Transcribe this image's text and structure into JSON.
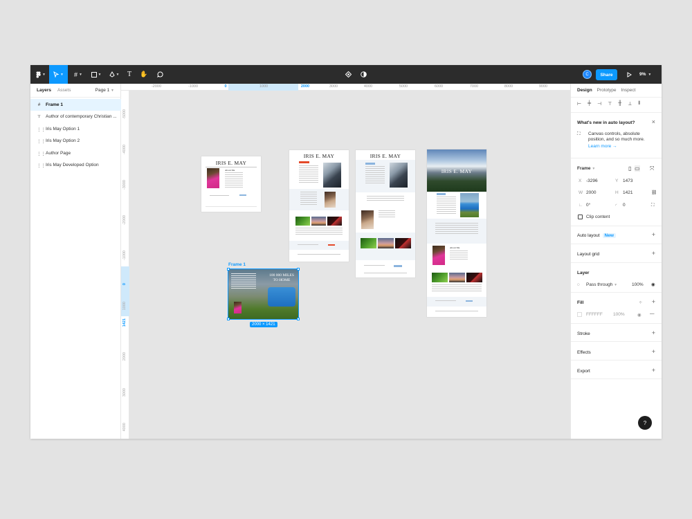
{
  "toolbar": {
    "tools": [
      "figma-menu",
      "move",
      "frame",
      "shape",
      "pen",
      "text",
      "hand",
      "comment"
    ],
    "avatar_initial": "C",
    "share_label": "Share",
    "zoom_label": "9%"
  },
  "layers_panel": {
    "tab_layers": "Layers",
    "tab_assets": "Assets",
    "page_label": "Page 1",
    "items": [
      {
        "icon": "frame-icon",
        "label": "Frame 1"
      },
      {
        "icon": "text-icon",
        "label": "Author of contemporary Christian ..."
      },
      {
        "icon": "grid-icon",
        "label": "Iris May Option 1"
      },
      {
        "icon": "grid-icon",
        "label": "Iris May Option 2"
      },
      {
        "icon": "grid-icon",
        "label": "Author Page"
      },
      {
        "icon": "grid-icon",
        "label": "Iris May Developed Option"
      }
    ]
  },
  "rulers": {
    "top_ticks": [
      "-2000",
      "-1000",
      "0",
      "1000",
      "2000",
      "3000",
      "4000",
      "5000",
      "6000",
      "7000",
      "8000",
      "9000"
    ],
    "left_ticks": [
      "-5000",
      "-4000",
      "-3000",
      "-2000",
      "-1000",
      "0",
      "1000",
      "1421",
      "2000",
      "3000",
      "4000"
    ]
  },
  "canvas": {
    "frame_label": "Frame 1",
    "size_badge": "2000 × 1421",
    "book_title": "100 000 MILES TO HOME",
    "site_title": "IRIS E. MAY",
    "about_heading": "About Me"
  },
  "design_panel": {
    "tab_design": "Design",
    "tab_prototype": "Prototype",
    "tab_inspect": "Inspect",
    "whats_new_title": "What's new in auto layout?",
    "whats_new_body": "Canvas controls, absolute position, and so much more.",
    "learn_more": "Learn more →",
    "frame_label": "Frame",
    "x_label": "X",
    "x_value": "-3296",
    "y_label": "Y",
    "y_value": "1473",
    "w_label": "W",
    "w_value": "2000",
    "h_label": "H",
    "h_value": "1421",
    "rotation_value": "0°",
    "radius_value": "0",
    "clip_content": "Clip content",
    "auto_layout": "Auto layout",
    "new_badge": "New",
    "layout_grid": "Layout grid",
    "layer_title": "Layer",
    "pass_through": "Pass through",
    "opacity": "100%",
    "fill_title": "Fill",
    "fill_hex": "FFFFFF",
    "fill_opacity": "100%",
    "stroke": "Stroke",
    "effects": "Effects",
    "export": "Export",
    "help": "?"
  }
}
